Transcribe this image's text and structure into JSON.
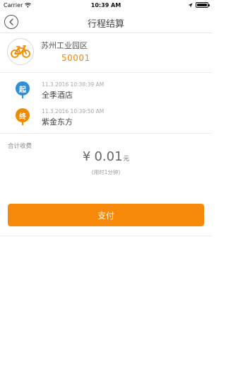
{
  "status_bar": {
    "carrier": "Carrier",
    "time": "10:39 AM"
  },
  "nav": {
    "title": "行程结算",
    "back_icon": "chevron-left-icon"
  },
  "bike": {
    "icon": "bicycle-icon",
    "station": "苏州工业园区",
    "number": "50001",
    "accent_color": "#f08a00"
  },
  "trip": {
    "start": {
      "marker": "起",
      "time": "11.3.2016 10:38:39 AM",
      "place": "全季酒店",
      "color": "#2d8fd8"
    },
    "end": {
      "marker": "终",
      "time": "11.3.2016 10:39:50 AM",
      "place": "紫金东方",
      "color": "#f08a00"
    }
  },
  "fee": {
    "label": "合计收费",
    "currency": "¥",
    "amount": "0.01",
    "unit": "元",
    "duration": "(用时1分钟)"
  },
  "actions": {
    "pay_label": "支付",
    "pay_color": "#f7890a"
  }
}
